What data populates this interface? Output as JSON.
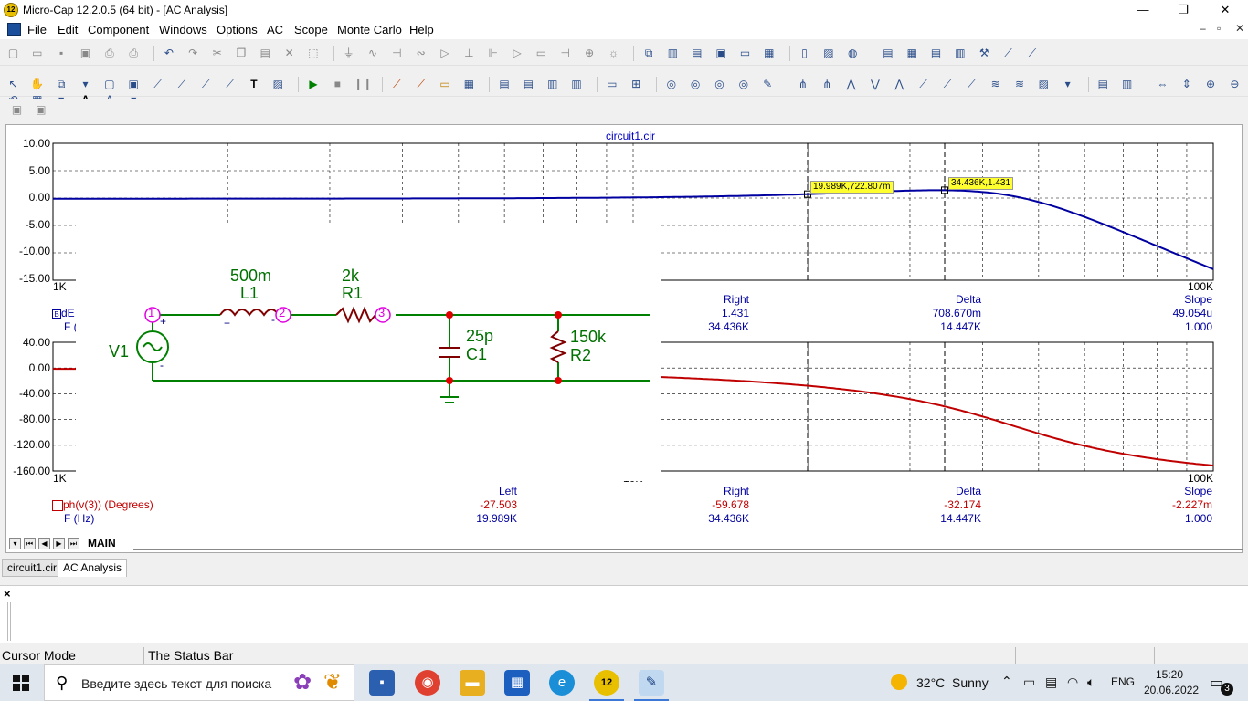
{
  "window": {
    "title": "Micro-Cap 12.2.0.5 (64 bit) - [AC Analysis]",
    "app_badge": "12",
    "minimize": "—",
    "restore": "❐",
    "close": "✕"
  },
  "menu": {
    "items": [
      "File",
      "Edit",
      "Component",
      "Windows",
      "Options",
      "AC",
      "Scope",
      "Monte Carlo",
      "Help"
    ],
    "mdi_minimize": "–",
    "mdi_restore": "▫",
    "mdi_close": "✕"
  },
  "plot": {
    "title": "circuit1.cir",
    "top": {
      "y_ticks": [
        "10.00",
        "5.00",
        "0.00",
        "-5.00",
        "-10.00",
        "-15.00"
      ],
      "x_left": "1K",
      "x_right": "100K",
      "ylim": [
        -15,
        10
      ],
      "trace_color": "#0000a0",
      "trace_name_fragment": "dE",
      "x_name_fragment": "F (",
      "cursor_left": {
        "label": "19.989K,722.807m",
        "x": 19989,
        "y": 0.722807
      },
      "cursor_right": {
        "label": "34.436K,1.431",
        "x": 34436,
        "y": 1.431
      },
      "readout": {
        "headers": [
          "Right",
          "Delta",
          "Slope"
        ],
        "row1": [
          "1.431",
          "708.670m",
          "49.054u"
        ],
        "row2": [
          "34.436K",
          "14.447K",
          "1.000"
        ]
      }
    },
    "bottom": {
      "y_ticks": [
        "40.00",
        "0.00",
        "-40.00",
        "-80.00",
        "-120.00",
        "-160.00"
      ],
      "x_left": "1K",
      "x_mid": "10K",
      "x_right": "100K",
      "ylim": [
        -160,
        40
      ],
      "trace_color": "#c00000",
      "trace_name": "ph(v(3)) (Degrees)",
      "x_name": "F (Hz)",
      "readout": {
        "headers": [
          "Left",
          "Right",
          "Delta",
          "Slope"
        ],
        "row1": [
          "-27.503",
          "-59.678",
          "-32.174",
          "-2.227m"
        ],
        "row2": [
          "19.989K",
          "34.436K",
          "14.447K",
          "1.000"
        ]
      }
    }
  },
  "schematic": {
    "L1_value": "500m",
    "L1_name": "L1",
    "R1_value": "2k",
    "R1_name": "R1",
    "C1_value": "25p",
    "C1_name": "C1",
    "R2_value": "150k",
    "R2_name": "R2",
    "V1_name": "V1",
    "nodes": [
      "1",
      "2",
      "3"
    ],
    "plus": "+",
    "minus": "-"
  },
  "page_tab": "MAIN",
  "doc_tabs": [
    "circuit1.cir",
    "AC Analysis"
  ],
  "output_close": "×",
  "status": {
    "mode": "Cursor Mode",
    "text": "The Status Bar"
  },
  "taskbar": {
    "search_placeholder": "Введите здесь текст для поиска",
    "weather_temp": "32°C",
    "weather_text": "Sunny",
    "lang": "ENG",
    "time": "15:20",
    "date": "20.06.2022",
    "notifications": "3",
    "micro_cap_badge": "12"
  }
}
